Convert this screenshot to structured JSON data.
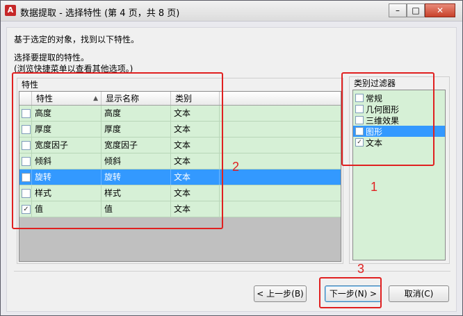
{
  "window": {
    "title": "数据提取 - 选择特性 (第 4 页，共 8 页)",
    "app_icon": "A",
    "buttons": [
      "–",
      "□",
      "✕"
    ]
  },
  "instructions": {
    "line1": "基于选定的对象，找到以下特性。",
    "line2": "选择要提取的特性。",
    "line3": "(浏览快捷菜单以查看其他选项。)"
  },
  "properties": {
    "group_title": "特性",
    "columns": [
      "特性",
      "显示名称",
      "类别"
    ],
    "rows": [
      {
        "checked": false,
        "property": "高度",
        "display": "高度",
        "category": "文本",
        "selected": false
      },
      {
        "checked": false,
        "property": "厚度",
        "display": "厚度",
        "category": "文本",
        "selected": false
      },
      {
        "checked": false,
        "property": "宽度因子",
        "display": "宽度因子",
        "category": "文本",
        "selected": false
      },
      {
        "checked": false,
        "property": "倾斜",
        "display": "倾斜",
        "category": "文本",
        "selected": false
      },
      {
        "checked": false,
        "property": "旋转",
        "display": "旋转",
        "category": "文本",
        "selected": true
      },
      {
        "checked": false,
        "property": "样式",
        "display": "样式",
        "category": "文本",
        "selected": false
      },
      {
        "checked": true,
        "property": "值",
        "display": "值",
        "category": "文本",
        "selected": false
      }
    ]
  },
  "filter": {
    "title": "类别过滤器",
    "items": [
      {
        "label": "常规",
        "checked": false,
        "selected": false
      },
      {
        "label": "几何图形",
        "checked": false,
        "selected": false
      },
      {
        "label": "三维效果",
        "checked": false,
        "selected": false
      },
      {
        "label": "图形",
        "checked": false,
        "selected": true
      },
      {
        "label": "文本",
        "checked": true,
        "selected": false
      }
    ]
  },
  "buttons": {
    "prev": "< 上一步(B)",
    "next": "下一步(N) >",
    "cancel": "取消(C)"
  },
  "annotations": [
    "1",
    "2",
    "3"
  ],
  "colors": {
    "grid_bg": "#d6f0d6",
    "selection": "#3399ff",
    "annotation": "#e02020"
  }
}
